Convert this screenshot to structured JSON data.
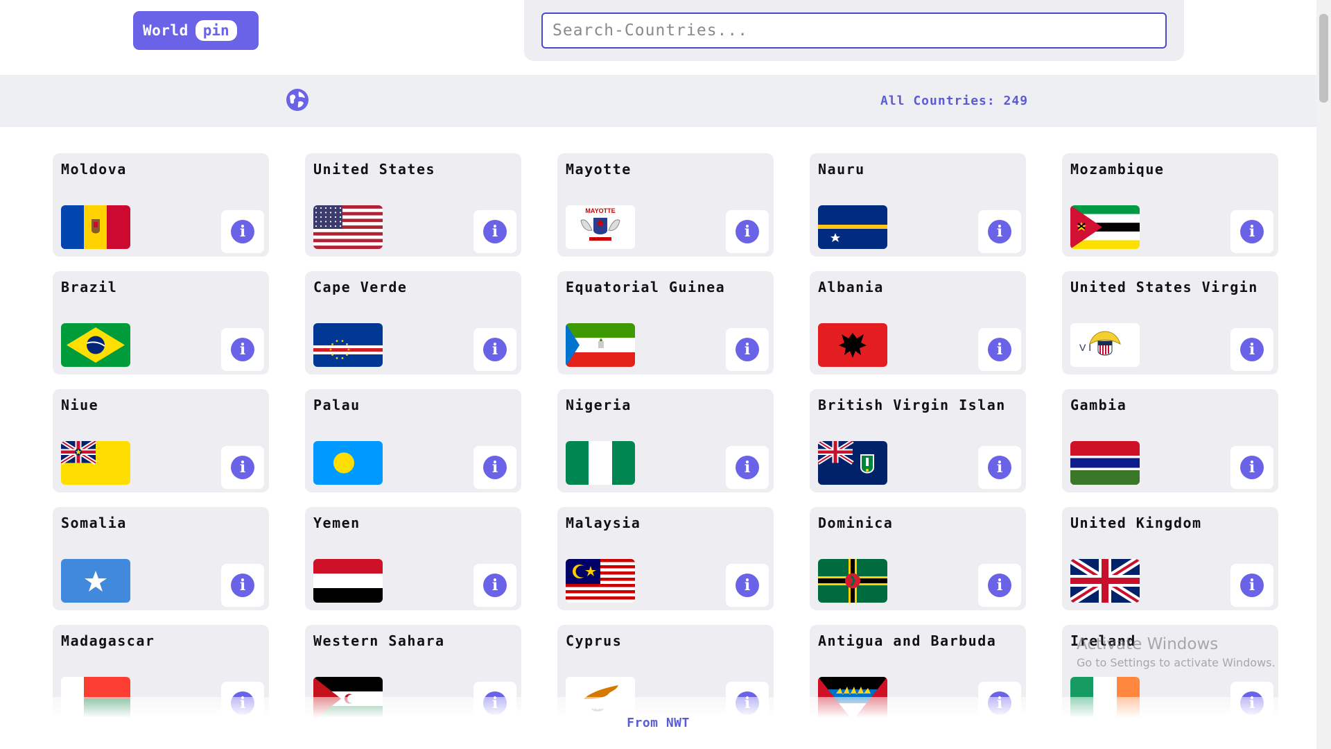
{
  "logo": {
    "word": "World",
    "pill": "pin"
  },
  "search": {
    "placeholder": "Search-Countries...",
    "value": ""
  },
  "info_bar": {
    "icon": "globe-icon",
    "count_text": "All Countries: 249"
  },
  "countries": [
    {
      "name": "Moldova",
      "flag": "moldova"
    },
    {
      "name": "United States",
      "flag": "united-states"
    },
    {
      "name": "Mayotte",
      "flag": "mayotte",
      "flag_text": "MAYOTTE"
    },
    {
      "name": "Nauru",
      "flag": "nauru"
    },
    {
      "name": "Mozambique",
      "flag": "mozambique"
    },
    {
      "name": "Brazil",
      "flag": "brazil"
    },
    {
      "name": "Cape Verde",
      "flag": "cape-verde"
    },
    {
      "name": "Equatorial Guinea",
      "flag": "equatorial-guinea"
    },
    {
      "name": "Albania",
      "flag": "albania"
    },
    {
      "name": "United States Virgin",
      "flag": "us-virgin-islands",
      "flag_text": "V I"
    },
    {
      "name": "Niue",
      "flag": "niue"
    },
    {
      "name": "Palau",
      "flag": "palau"
    },
    {
      "name": "Nigeria",
      "flag": "nigeria"
    },
    {
      "name": "British Virgin Islan",
      "flag": "british-virgin-islands"
    },
    {
      "name": "Gambia",
      "flag": "gambia"
    },
    {
      "name": "Somalia",
      "flag": "somalia"
    },
    {
      "name": "Yemen",
      "flag": "yemen"
    },
    {
      "name": "Malaysia",
      "flag": "malaysia"
    },
    {
      "name": "Dominica",
      "flag": "dominica"
    },
    {
      "name": "United Kingdom",
      "flag": "united-kingdom"
    },
    {
      "name": "Madagascar",
      "flag": "madagascar"
    },
    {
      "name": "Western Sahara",
      "flag": "western-sahara"
    },
    {
      "name": "Cyprus",
      "flag": "cyprus"
    },
    {
      "name": "Antigua and Barbuda",
      "flag": "antigua-and-barbuda"
    },
    {
      "name": "Ireland",
      "flag": "ireland"
    }
  ],
  "card_button_icon": "info-icon",
  "footer": {
    "text": "From NWT"
  },
  "watermark": {
    "title": "Activate Windows",
    "subtitle": "Go to Settings to activate Windows."
  },
  "colors": {
    "accent": "#6a63e8",
    "accent_text": "#5b5bd6",
    "card_bg": "#eeeef2",
    "bar_bg": "#eeeff3"
  }
}
